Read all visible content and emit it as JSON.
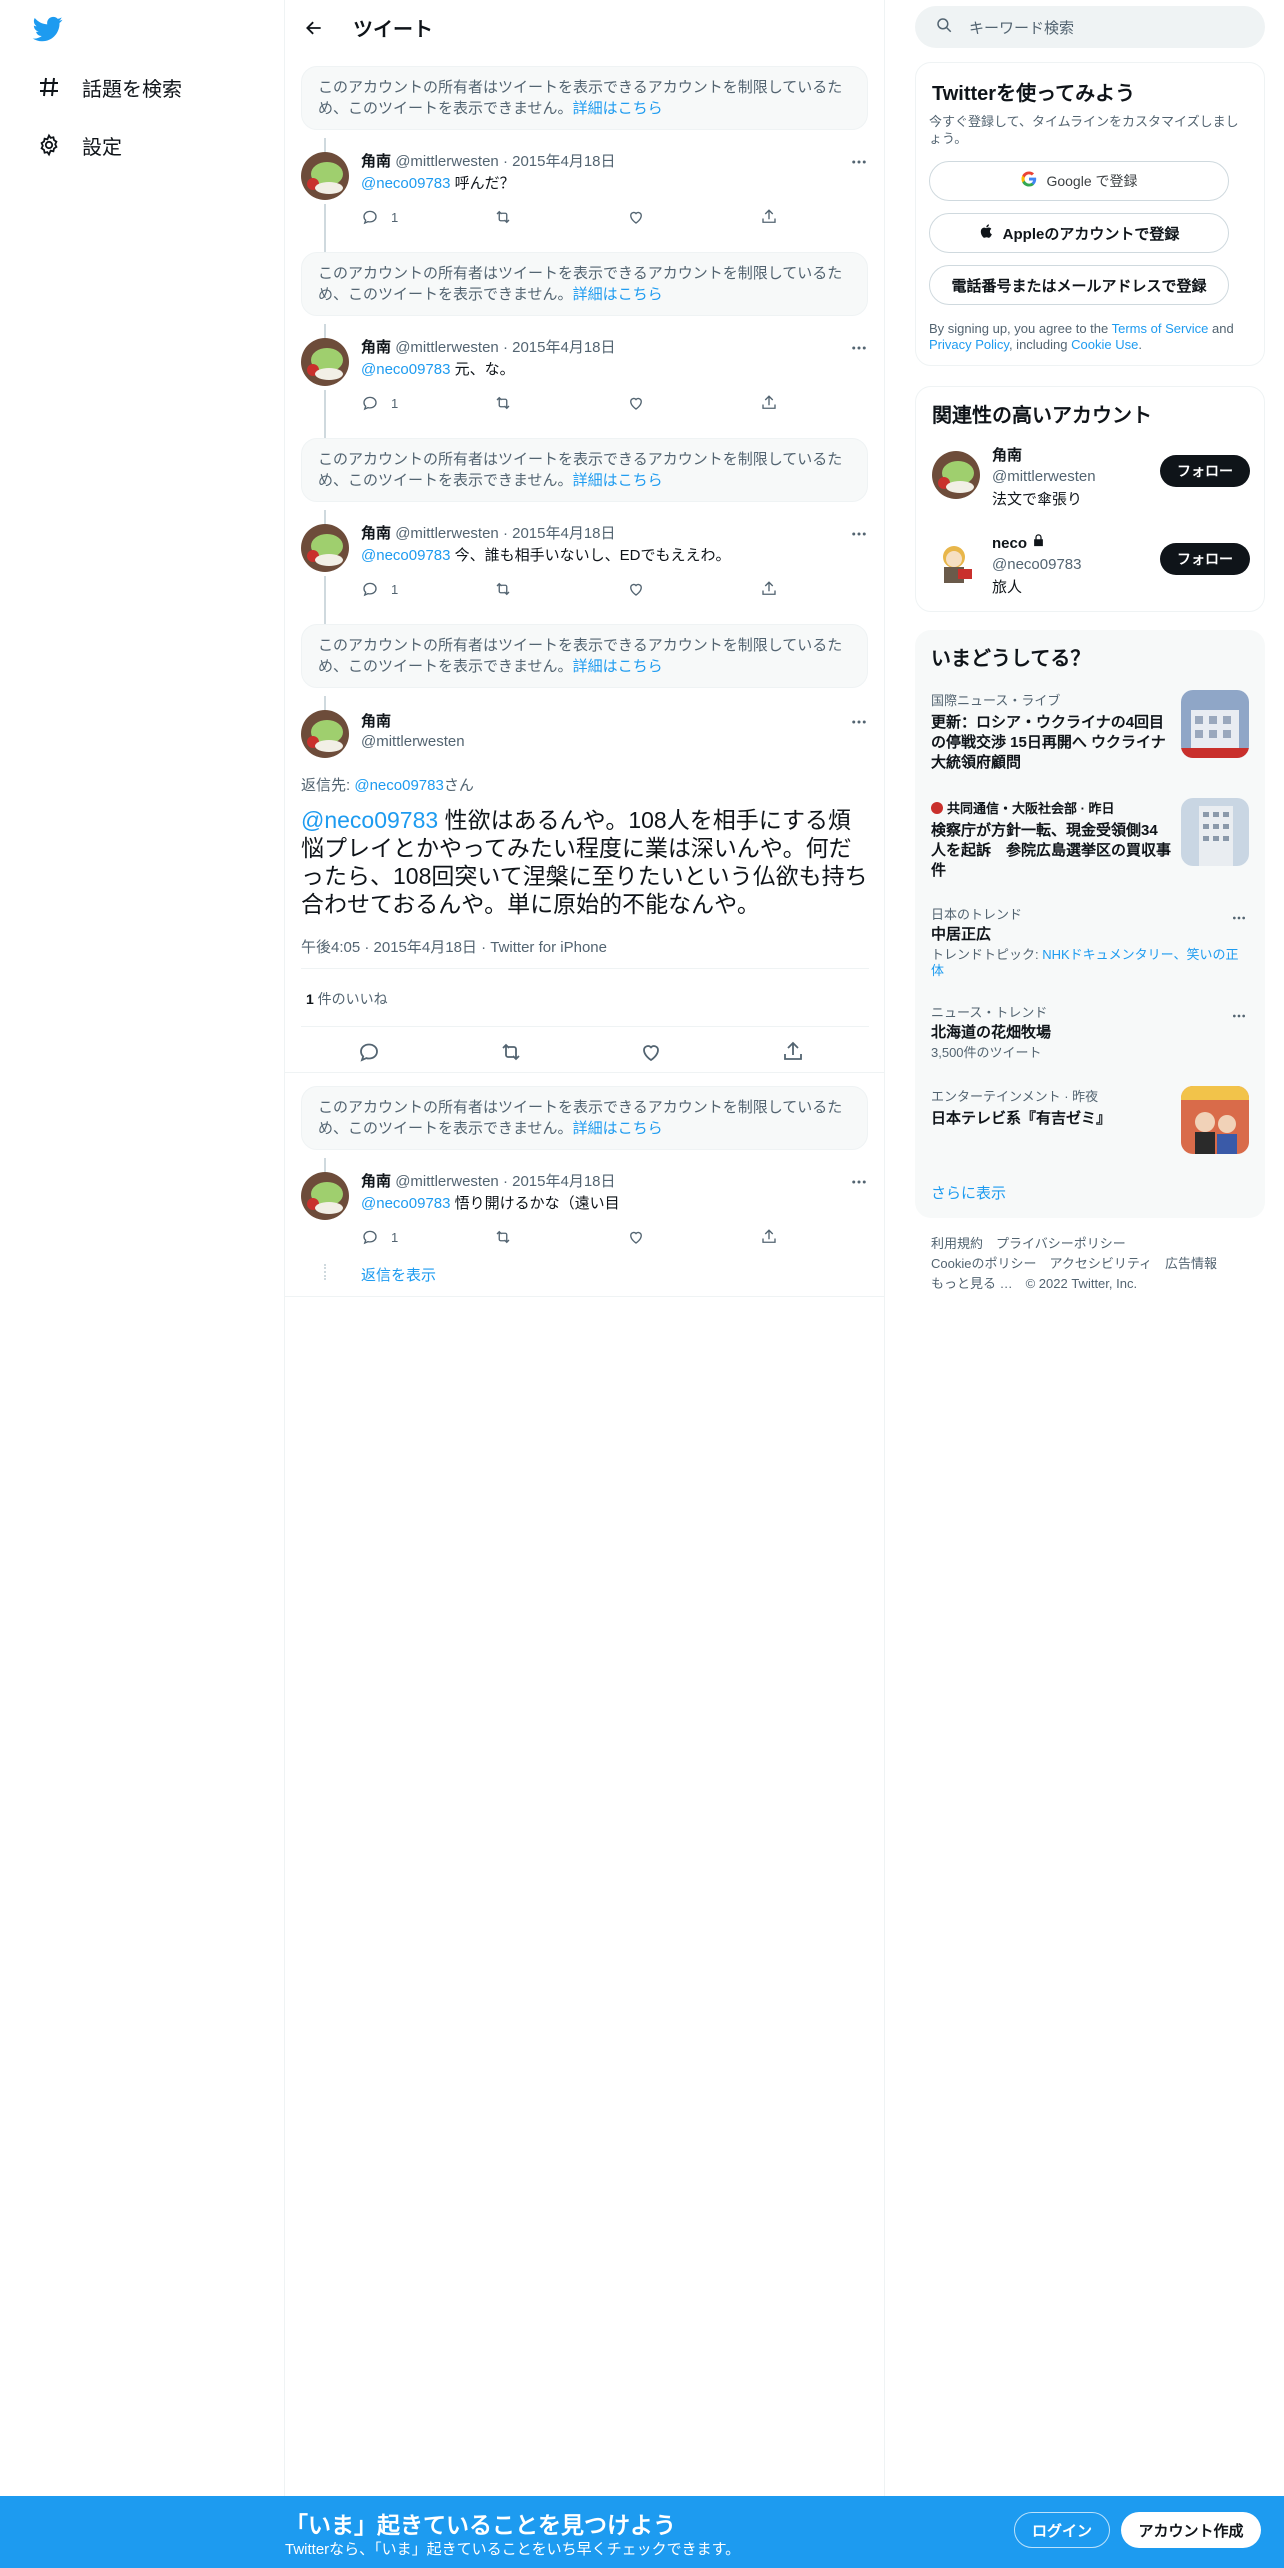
{
  "nav": {
    "explore_label": "話題を検索",
    "settings_label": "設定"
  },
  "header": {
    "title": "ツイート"
  },
  "blocked_notice": {
    "text": "このアカウントの所有者はツイートを表示できるアカウントを制限しているため、このツイートを表示できません。",
    "link": "詳細はこちら"
  },
  "replies": [
    {
      "name": "角南",
      "handle": "@mittlerwesten",
      "dot": "·",
      "date": "2015年4月18日",
      "mention": "@neco09783",
      "text": "呼んだ？",
      "reply_count": "1"
    },
    {
      "name": "角南",
      "handle": "@mittlerwesten",
      "dot": "·",
      "date": "2015年4月18日",
      "mention": "@neco09783",
      "text": "元、な。",
      "reply_count": "1"
    },
    {
      "name": "角南",
      "handle": "@mittlerwesten",
      "dot": "·",
      "date": "2015年4月18日",
      "mention": "@neco09783",
      "text": "今、誰も相手いないし、EDでもええわ。",
      "reply_count": "1"
    }
  ],
  "main_tweet": {
    "name": "角南",
    "handle": "@mittlerwesten",
    "reply_to_prefix": "返信先: ",
    "reply_to_handle": "@neco09783",
    "reply_to_suffix": "さん",
    "mention": "@neco09783",
    "text": " 性欲はあるんや。108人を相手にする煩悩プレイとかやってみたい程度に業は深いんや。何だったら、108回突いて涅槃に至りたいという仏欲も持ち合わせておるんや。単に原始的不能なんや。",
    "time": "午後4:05 · 2015年4月18日 · Twitter for iPhone",
    "likes_count": "1",
    "likes_label": " 件のいいね"
  },
  "last_reply": {
    "name": "角南",
    "handle": "@mittlerwesten",
    "dot": "·",
    "date": "2015年4月18日",
    "mention": "@neco09783",
    "text": "悟り開けるかな（遠い目",
    "reply_count": "1",
    "show_replies": "返信を表示"
  },
  "search": {
    "placeholder": "キーワード検索"
  },
  "signup_card": {
    "title": "Twitterを使ってみよう",
    "subtitle": "今すぐ登録して、タイムラインをカスタマイズしましょう。",
    "google": "Google で登録",
    "apple": "Appleのアカウントで登録",
    "phone": "電話番号またはメールアドレスで登録",
    "terms_pre": "By signing up, you agree to the ",
    "terms_link": "Terms of Service",
    "terms_and": " and ",
    "privacy_link": "Privacy Policy",
    "terms_incl": ", including ",
    "cookie_link": "Cookie Use",
    "terms_end": "."
  },
  "relevant": {
    "title": "関連性の高いアカウント",
    "accounts": [
      {
        "name": "角南",
        "handle": "@mittlerwesten",
        "bio": "法文で傘張り",
        "follow": "フォロー"
      },
      {
        "name": "neco",
        "handle": "@neco09783",
        "bio": "旅人",
        "follow": "フォロー"
      }
    ]
  },
  "trends": {
    "title": "いまどうしてる？",
    "items": [
      {
        "cat": "国際ニュース・ライブ",
        "title": "更新：ロシア・ウクライナの4回目の停戦交渉 15日再開へ ウクライナ大統領府顧問"
      },
      {
        "cat": "共同通信・大阪社会部 · 昨日",
        "title": "検察庁が方針一転、現金受領側34人を起訴　参院広島選挙区の買収事件"
      },
      {
        "cat": "日本のトレンド",
        "title": "中居正広",
        "sub_pre": "トレンドトピック: ",
        "sub_link": "NHKドキュメンタリー、笑いの正体"
      },
      {
        "cat": "ニュース・トレンド",
        "title": "北海道の花畑牧場",
        "sub": "3,500件のツイート"
      },
      {
        "cat": "エンターテインメント · 昨夜",
        "title": "日本テレビ系『有吉ゼミ』"
      }
    ],
    "show_more": "さらに表示"
  },
  "footer": {
    "line1": "利用規約　プライバシーポリシー",
    "line2": "Cookieのポリシー　アクセシビリティ　広告情報",
    "line3": "もっと見る …　© 2022 Twitter, Inc."
  },
  "bottombar": {
    "headline": "「いま」起きていることを見つけよう",
    "sub": "Twitterなら、「いま」起きていることをいち早くチェックできます。",
    "login": "ログイン",
    "signup": "アカウント作成"
  },
  "colors": {
    "accent": "#1d9bf0",
    "text": "#0f1419",
    "muted": "#536471"
  },
  "icons": [
    "twitter-logo-icon",
    "hashtag-icon",
    "gear-icon",
    "back-arrow-icon",
    "search-icon",
    "reply-icon",
    "retweet-icon",
    "like-icon",
    "share-icon",
    "more-icon",
    "google-icon",
    "apple-icon",
    "lock-icon"
  ]
}
